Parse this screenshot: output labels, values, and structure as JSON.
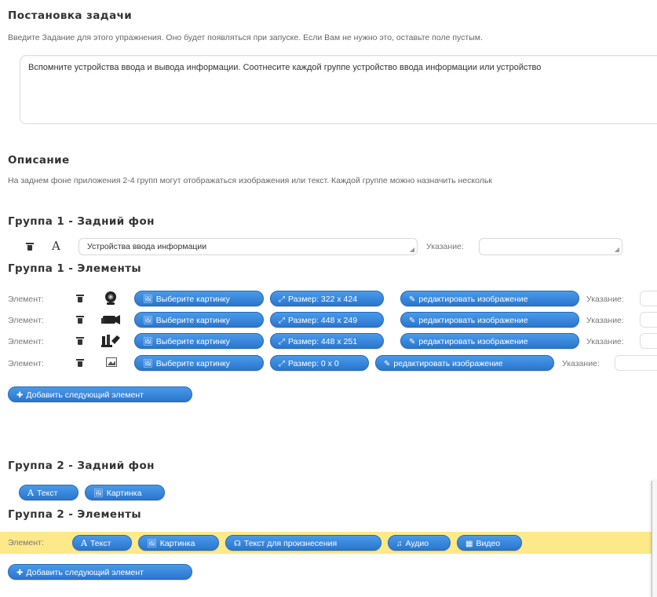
{
  "task": {
    "heading": "Постановка задачи",
    "help": "Введите Задание для этого упражнения. Оно будет появляться при запуске. Если Вам не нужно это, оставьте поле пустым.",
    "value": "Вспомните устройства ввода и вывода информации. Соотнесите каждой группе устройство ввода информации или устройство"
  },
  "description": {
    "heading": "Описание",
    "text": "На заднем фоне приложения 2-4 групп могут отображаться изображения или текст. Каждой группе можно назначить нескольк"
  },
  "group1": {
    "bg_heading": "Группа 1 - Задний фон",
    "bg_type_glyph": "A",
    "bg_value": "Устройства ввода информации",
    "hint_label": "Указание:",
    "elements_heading": "Группа 1 - Элементы",
    "element_label": "Элемент:",
    "choose_image": "Выберите картинку",
    "edit_image": "редактировать изображение",
    "elements": [
      {
        "size": "Размер: 322 x 424",
        "thumb": "webcam"
      },
      {
        "size": "Размер: 448 x 249",
        "thumb": "video-camera"
      },
      {
        "size": "Размер: 448 x 251",
        "thumb": "microphone"
      },
      {
        "size": "Размер: 0 x 0",
        "thumb": "image-placeholder"
      }
    ],
    "add_element": "Добавить следующий элемент"
  },
  "group2": {
    "bg_heading": "Группа 2 - Задний фон",
    "text_btn": "Текст",
    "image_btn": "Картинка",
    "elements_heading": "Группа 2 - Элементы",
    "element_label": "Элемент:",
    "speech_btn": "Текст для произнесения",
    "audio_btn": "Аудио",
    "video_btn": "Видео",
    "add_element": "Добавить следующий элемент"
  },
  "colors": {
    "button": "#2f7fd6",
    "highlight": "#fde98a"
  }
}
